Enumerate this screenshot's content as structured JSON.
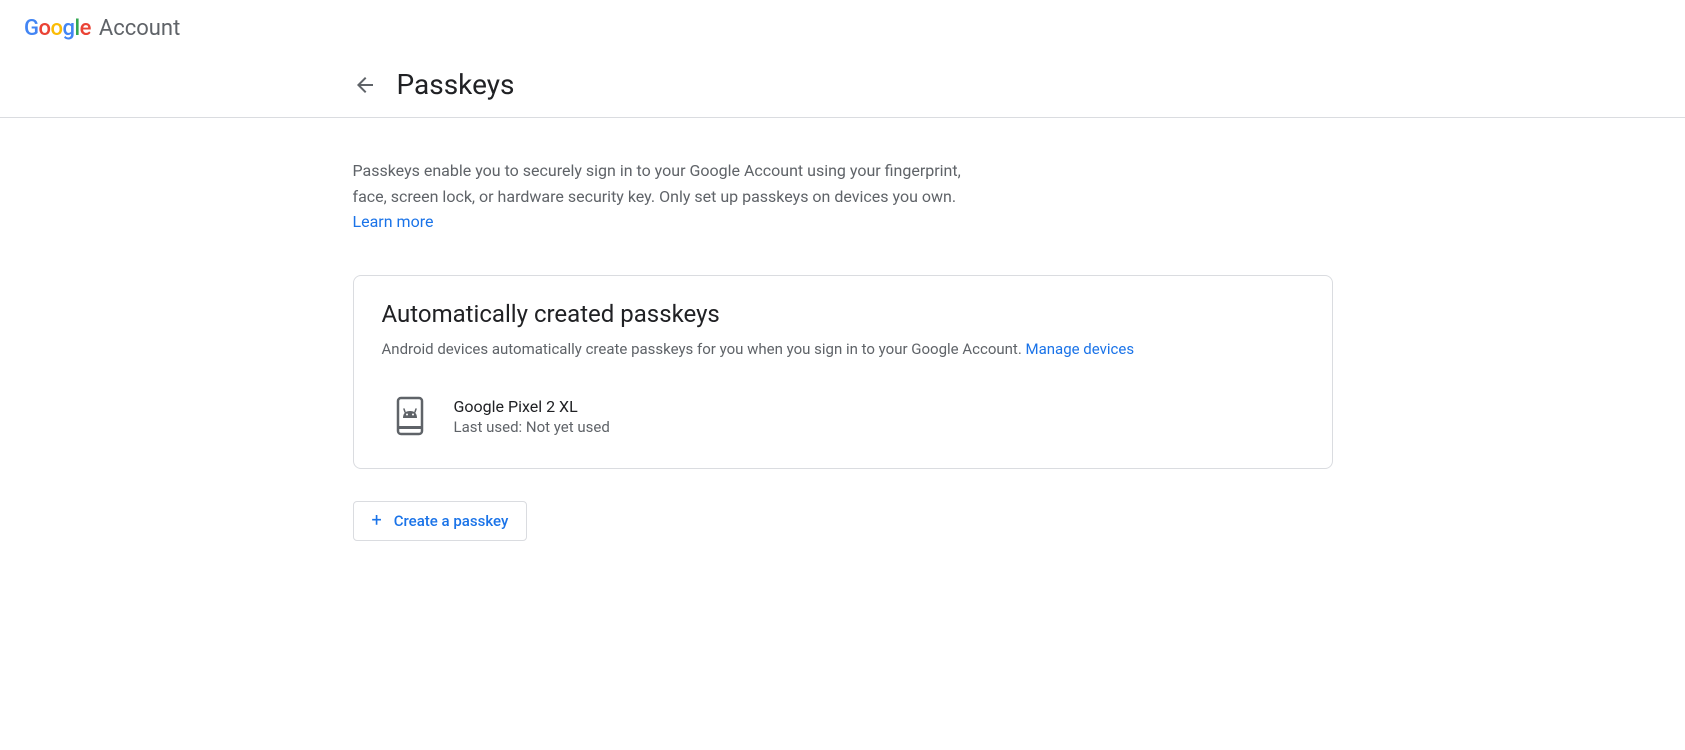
{
  "header": {
    "product": "Account"
  },
  "page": {
    "title": "Passkeys",
    "intro_text": "Passkeys enable you to securely sign in to your Google Account using your fingerprint, face, screen lock, or hardware security key. Only set up passkeys on devices you own. ",
    "learn_more": "Learn more"
  },
  "card": {
    "title": "Automatically created passkeys",
    "subtitle": "Android devices automatically create passkeys for you when you sign in to your Google Account. ",
    "manage_link": "Manage devices",
    "devices": [
      {
        "name": "Google Pixel 2 XL",
        "status": "Last used: Not yet used"
      }
    ]
  },
  "actions": {
    "create_passkey": "Create a passkey"
  }
}
